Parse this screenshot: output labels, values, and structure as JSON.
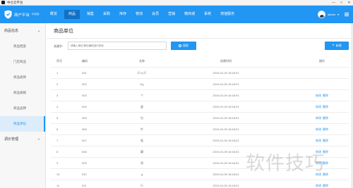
{
  "window": {
    "title": "中仓云平台",
    "minimize_label": "—",
    "maximize_label": "□",
    "close_label": "✕"
  },
  "brand": {
    "name": "商户平台",
    "env": "标准版",
    "logo_color": "#ffffff"
  },
  "nav": {
    "items": [
      "概览",
      "商品",
      "销售",
      "采购",
      "库存",
      "物流",
      "会员",
      "营销",
      "微商城",
      "系统",
      "增值服务"
    ],
    "active_index": 1,
    "user": "admin",
    "user_chevron": "▾"
  },
  "sidebar": {
    "groups": [
      {
        "label": "商品信息",
        "caret": "▴",
        "items": [
          "商品档案",
          "门店商品",
          "商品类目",
          "商品规格",
          "商品品牌",
          "商品单位"
        ]
      },
      {
        "label": "调价管理",
        "caret": "▾",
        "items": []
      }
    ],
    "active_item": "商品单位"
  },
  "page": {
    "title": "商品单位",
    "search_label": "关键字:",
    "search_placeholder": "请输入单位/单位编码进行查询",
    "search_button": "搜索",
    "add_button": "新建"
  },
  "table": {
    "columns": [
      "序号",
      "编码",
      "名称",
      "创建时间",
      "操作"
    ],
    "edit_label": "修改",
    "delete_label": "删除",
    "rows": [
      {
        "no": "1",
        "code": "001",
        "name": "斤/公斤",
        "time": "2019-01-09 18:18:01",
        "ops": false
      },
      {
        "no": "2",
        "code": "002",
        "name": "Kg",
        "time": "2019-01-09 18:18:01",
        "ops": false
      },
      {
        "no": "3",
        "code": "003",
        "name": "个",
        "time": "2019-01-09 18:18:01",
        "ops": true
      },
      {
        "no": "4",
        "code": "004",
        "name": "盒",
        "time": "2019-01-09 18:18:01",
        "ops": true
      },
      {
        "no": "5",
        "code": "005",
        "name": "包",
        "time": "2019-01-09 18:18:01",
        "ops": true
      },
      {
        "no": "6",
        "code": "006",
        "name": "件",
        "time": "2019-01-09 18:18:01",
        "ops": true
      },
      {
        "no": "7",
        "code": "007",
        "name": "瓶",
        "time": "2019-01-09 18:18:01",
        "ops": true
      },
      {
        "no": "8",
        "code": "008",
        "name": "罐",
        "time": "2019-01-09 18:18:01",
        "ops": true
      },
      {
        "no": "9",
        "code": "009",
        "name": "袋",
        "time": "2019-01-09 18:18:01",
        "ops": true
      },
      {
        "no": "10",
        "code": "010",
        "name": "g",
        "time": "2019-01-09 18:18:01",
        "ops": true
      },
      {
        "no": "11",
        "code": "011",
        "name": "斤",
        "time": "2019-01-09 18:18:01",
        "ops": true
      }
    ]
  },
  "watermark": "软件技巧",
  "colors": {
    "primary": "#2196f3",
    "nav_active": "#1270c5",
    "sidebar_active_bg": "#dcecfb"
  }
}
